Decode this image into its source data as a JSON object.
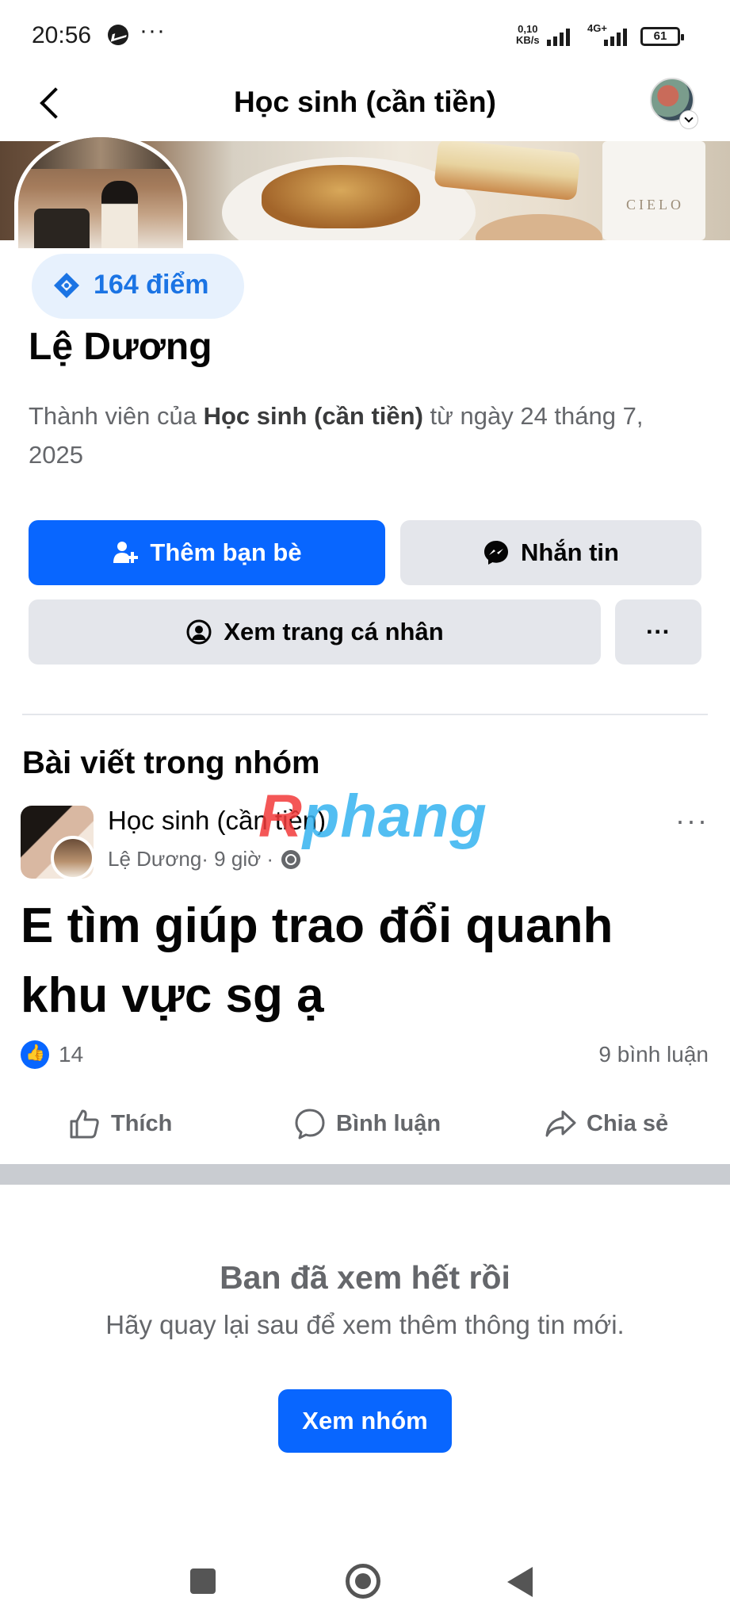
{
  "status_bar": {
    "time": "20:56",
    "dots": "···",
    "speed_value": "0,10",
    "speed_unit": "KB/s",
    "net_type": "4G+",
    "battery": "61"
  },
  "header": {
    "title": "Học sinh (cần tiền)"
  },
  "cover": {
    "cup_text": "CIELO"
  },
  "profile": {
    "points": "164 điểm",
    "name": "Lệ Dương",
    "member_prefix": "Thành viên của ",
    "member_group": "Học sinh (cần tiền)",
    "member_suffix": " từ ngày 24 tháng 7, 2025"
  },
  "actions": {
    "add_friend": "Thêm bạn bè",
    "message": "Nhắn tin",
    "view_profile": "Xem trang cá nhân",
    "more": "···"
  },
  "section": {
    "title": "Bài viết trong nhóm"
  },
  "post": {
    "group": "Học sinh (cần tiền)",
    "author": "Lệ Dương",
    "time": " · 9 giờ · ",
    "text": "E tìm giúp trao đổi quanh khu vực sg ạ",
    "like_count": "14",
    "comment_count": "9 bình luận",
    "like_label": "Thích",
    "comment_label": "Bình luận",
    "share_label": "Chia sẻ",
    "more": "···"
  },
  "watermark": {
    "r": "R",
    "rest": "phang"
  },
  "end": {
    "title": "Ban đã xem hết rồi",
    "subtitle": "Hãy quay lại sau để xem thêm thông tin mới.",
    "button": "Xem nhóm"
  },
  "colors": {
    "primary": "#0866ff",
    "secondary_bg": "#e4e6eb",
    "muted_text": "#65676b",
    "points_bg": "#e7f1fd"
  }
}
